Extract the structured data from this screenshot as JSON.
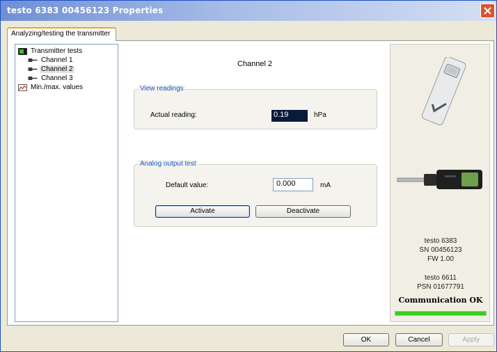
{
  "window": {
    "title": "testo 6383 00456123 Properties"
  },
  "tab": {
    "label": "Analyzing/testing the transmitter"
  },
  "tree": {
    "items": [
      {
        "label": "Transmitter tests"
      },
      {
        "label": "Channel 1"
      },
      {
        "label": "Channel 2"
      },
      {
        "label": "Channel 3"
      },
      {
        "label": "Min./max. values"
      }
    ],
    "selected_index": 2
  },
  "main": {
    "channel_title": "Channel 2",
    "view_readings": {
      "legend": "View readings",
      "label": "Actual reading:",
      "value": "0.19",
      "unit": "hPa"
    },
    "analog_output": {
      "legend": "Analog output test",
      "label": "Default value:",
      "value": "0.000",
      "unit": "mA",
      "activate_label": "Activate",
      "deactivate_label": "Deactivate"
    }
  },
  "device": {
    "model": "testo 6383",
    "serial": "SN 00456123",
    "firmware": "FW  1.00",
    "probe_model": "testo 6611",
    "probe_serial": "PSN 01677791",
    "status": "Communication OK",
    "progress": 1.0,
    "status_color": "#35d01b"
  },
  "footer": {
    "ok_label": "OK",
    "cancel_label": "Cancel",
    "apply_label": "Apply"
  }
}
